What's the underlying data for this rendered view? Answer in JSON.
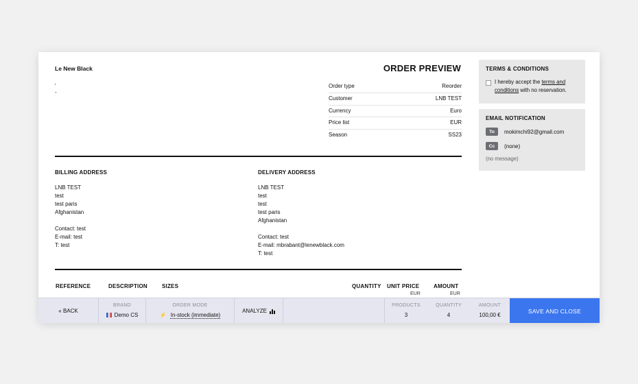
{
  "document": {
    "brand_name": "Le New Black",
    "address_lines": [
      "'",
      "-"
    ],
    "title": "ORDER PREVIEW",
    "meta": [
      {
        "label": "Order type",
        "value": "Reorder"
      },
      {
        "label": "Customer",
        "value": "LNB TEST"
      },
      {
        "label": "Currency",
        "value": "Euro"
      },
      {
        "label": "Price list",
        "value": "EUR"
      },
      {
        "label": "Season",
        "value": "SS23"
      }
    ],
    "billing": {
      "heading": "BILLING ADDRESS",
      "lines": [
        "LNB TEST",
        "test",
        "test paris",
        "Afghanistan"
      ],
      "contact": [
        "Contact: test",
        "E-mail: test",
        "T: test"
      ]
    },
    "delivery": {
      "heading": "DELIVERY ADDRESS",
      "lines": [
        "LNB TEST",
        "test",
        "test",
        "test paris",
        "Afghanistan"
      ],
      "contact": [
        "Contact: test",
        "E-mail: mbrabant@lenewblack.com",
        "T: test"
      ]
    },
    "table_headers": {
      "reference": "REFERENCE",
      "description": "DESCRIPTION",
      "sizes": "SIZES",
      "quantity": "QUANTITY",
      "unit_price": "UNIT PRICE",
      "unit_price_currency": "EUR",
      "amount": "AMOUNT",
      "amount_currency": "EUR"
    }
  },
  "terms": {
    "title": "TERMS & CONDITIONS",
    "text_before": "I hereby accept the ",
    "link": "terms and conditions",
    "text_after": " with no reservation.",
    "checked": false
  },
  "email": {
    "title": "EMAIL NOTIFICATION",
    "to_tag": "To",
    "to_value": "mokimchi92@gmail.com",
    "cc_tag": "Cc",
    "cc_value": "(none)",
    "message": "(no message)"
  },
  "bottom_bar": {
    "back_label": "« BACK",
    "brand_label": "BRAND",
    "brand_value": "Demo CS",
    "order_mode_label": "ORDER MODE",
    "order_mode_value": "In-stock (immediate)",
    "analyze_label": "ANALYZE",
    "products_label": "PRODUCTS",
    "products_value": "3",
    "quantity_label": "QUANTITY",
    "quantity_value": "4",
    "amount_label": "AMOUNT",
    "amount_value": "100,00 €",
    "save_label": "SAVE AND CLOSE"
  },
  "colors": {
    "accent": "#3b76ef",
    "panel_bg": "#e8e8e9",
    "bar_bg": "#e6e6f0",
    "tag_bg": "#6d6e74"
  },
  "icons": {
    "brand": "french-flag-icon",
    "order_mode": "lightning-bolt-icon",
    "analyze": "bar-chart-icon",
    "terms_checkbox": "checkbox-icon"
  }
}
